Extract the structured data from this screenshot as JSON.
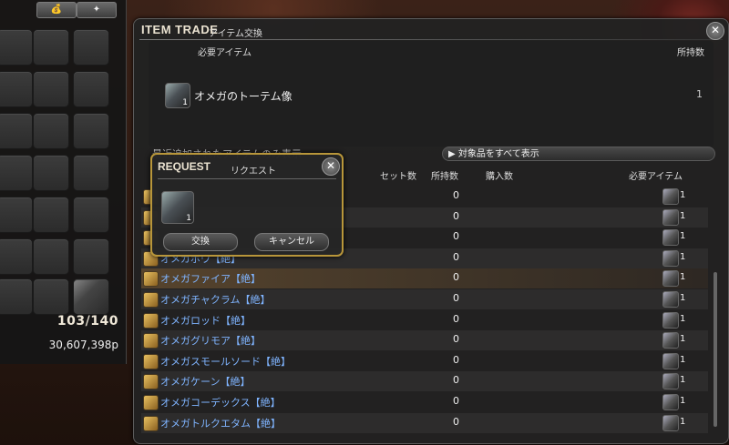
{
  "inventory": {
    "tab_left": "💰",
    "tab_right": "✦",
    "count_current": "103",
    "count_sep": "/",
    "count_max": "140",
    "gil": "30,607,398p"
  },
  "trade": {
    "title": "ITEM TRADE",
    "subtitle": "アイテム交換",
    "col_required": "必要アイテム",
    "col_owned": "所持数",
    "required_item": {
      "name": "オメガのトーテム像",
      "qty_badge": "1",
      "owned": "1"
    },
    "filter_label": "最近追加されたアイテムのみ表示",
    "show_all": "▶ 対象品をすべて表示",
    "headers": {
      "set": "セット数",
      "owned": "所持数",
      "buy": "購入数",
      "required": "必要アイテム"
    },
    "rows": [
      {
        "name": "",
        "owned": "0",
        "req": "1"
      },
      {
        "name": "",
        "owned": "0",
        "req": "1"
      },
      {
        "name": "",
        "owned": "0",
        "req": "1"
      },
      {
        "name": "オメガボウ【絶】",
        "owned": "0",
        "req": "1"
      },
      {
        "name": "オメガファイア【絶】",
        "owned": "0",
        "req": "1"
      },
      {
        "name": "オメガチャクラム【絶】",
        "owned": "0",
        "req": "1"
      },
      {
        "name": "オメガロッド【絶】",
        "owned": "0",
        "req": "1"
      },
      {
        "name": "オメガグリモア【絶】",
        "owned": "0",
        "req": "1"
      },
      {
        "name": "オメガスモールソード【絶】",
        "owned": "0",
        "req": "1"
      },
      {
        "name": "オメガケーン【絶】",
        "owned": "0",
        "req": "1"
      },
      {
        "name": "オメガコーデックス【絶】",
        "owned": "0",
        "req": "1"
      },
      {
        "name": "オメガトルクエタム【絶】",
        "owned": "0",
        "req": "1"
      }
    ]
  },
  "request": {
    "title": "REQUEST",
    "subtitle": "リクエスト",
    "item_qty": "1",
    "confirm": "交換",
    "cancel": "キャンセル"
  },
  "icons": {
    "close": "close-icon",
    "item": "omega-totem-icon"
  }
}
